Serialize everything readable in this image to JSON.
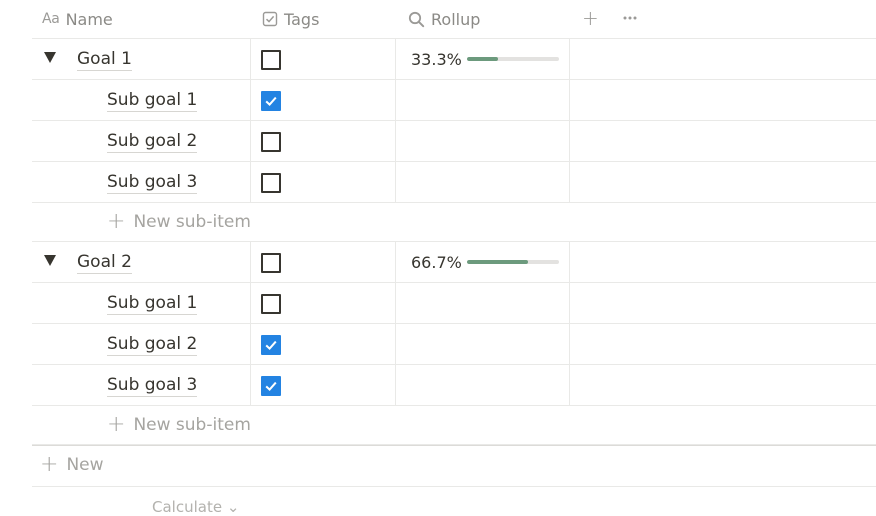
{
  "header": {
    "name_icon": "Aa",
    "name_label": "Name",
    "tags_label": "Tags",
    "rollup_label": "Rollup",
    "add_icon": "+",
    "more_icon": "···"
  },
  "groups": [
    {
      "title": "Goal 1",
      "checked": false,
      "rollup_text": "33.3%",
      "rollup_fraction": 0.333,
      "subs": [
        {
          "title": "Sub goal 1",
          "checked": true
        },
        {
          "title": "Sub goal 2",
          "checked": false
        },
        {
          "title": "Sub goal 3",
          "checked": false
        }
      ],
      "new_sub_label": "New sub-item"
    },
    {
      "title": "Goal 2",
      "checked": false,
      "rollup_text": "66.7%",
      "rollup_fraction": 0.667,
      "subs": [
        {
          "title": "Sub goal 1",
          "checked": false
        },
        {
          "title": "Sub goal 2",
          "checked": true
        },
        {
          "title": "Sub goal 3",
          "checked": true
        }
      ],
      "new_sub_label": "New sub-item"
    }
  ],
  "new_row_label": "New",
  "calculate_label": "Calculate ⌄",
  "colors": {
    "checkbox_checked": "#2383e2",
    "progress_fill": "#6c9a7d",
    "progress_track": "#e3e2e0",
    "muted_text": "#a5a4a0"
  }
}
